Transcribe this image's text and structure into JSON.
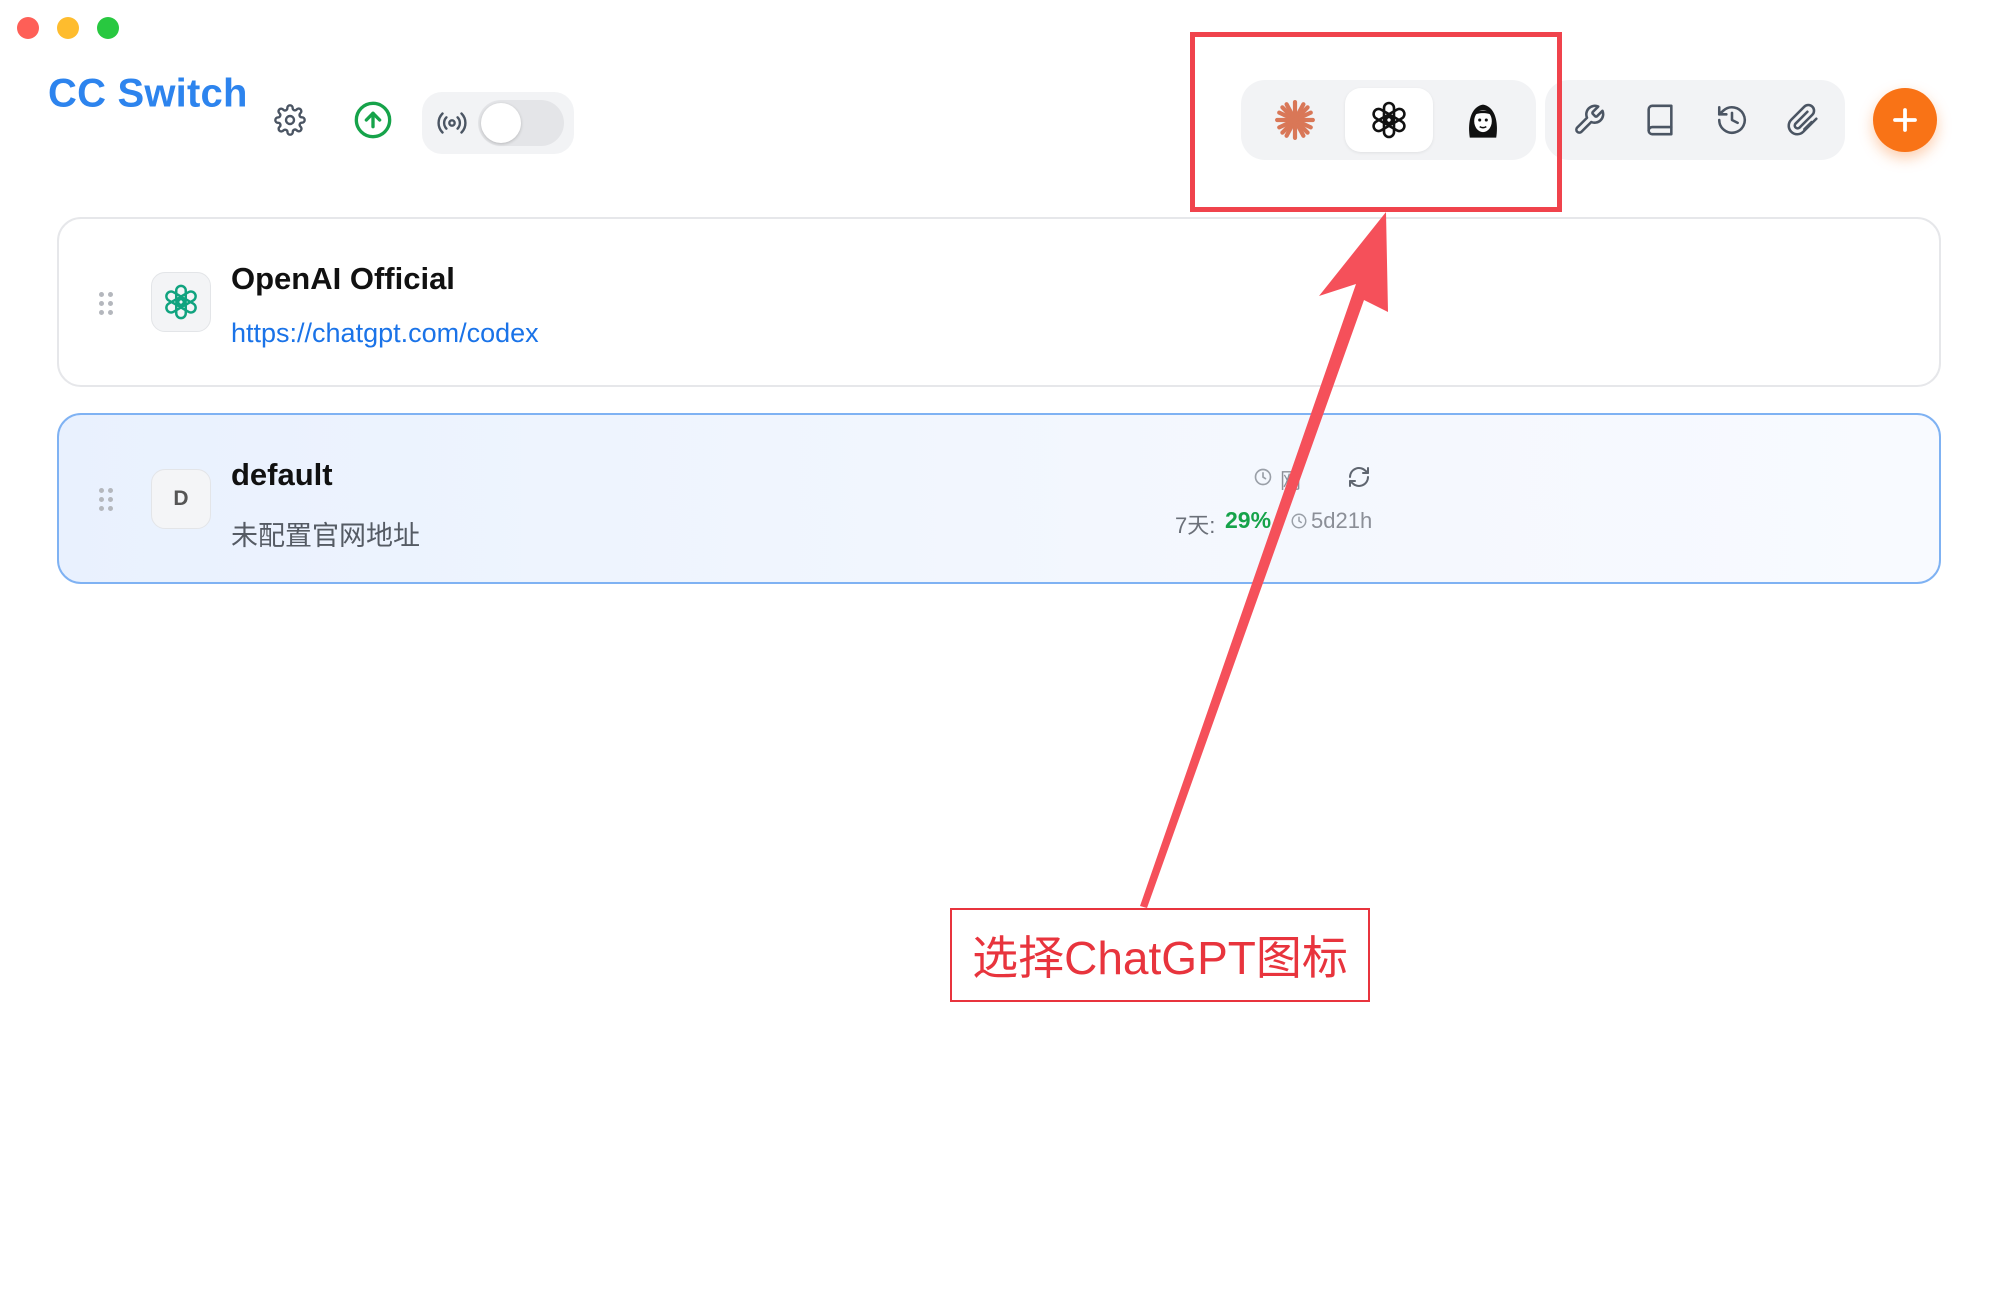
{
  "window": {
    "traffic_lights": {
      "close": "#fe5f57",
      "minimize": "#febc2e",
      "zoom": "#28c840"
    }
  },
  "header": {
    "title": "CC Switch",
    "accent": "#2d84ee",
    "proxy_toggle": {
      "on": false
    },
    "app_switcher": [
      {
        "name": "claude-icon",
        "active": false
      },
      {
        "name": "openai-icon",
        "active": true
      },
      {
        "name": "gemini-icon",
        "active": false
      }
    ],
    "tools": [
      "wrench-icon",
      "book-icon",
      "history-icon",
      "paperclip-icon"
    ],
    "add_color": "#f97316"
  },
  "providers": [
    {
      "name": "OpenAI Official",
      "url": "https://chatgpt.com/codex",
      "icon": "openai-icon",
      "selected": false
    },
    {
      "name": "default",
      "subtitle": "未配置官网地址",
      "avatar_letter": "D",
      "selected": true,
      "usage": {
        "updated": "刚",
        "window_label": "7天:",
        "percent": "29%",
        "reset": "5d21h",
        "percent_color": "#16a34a"
      }
    }
  ],
  "annotation": {
    "label": "选择ChatGPT图标",
    "color": "#f0434c"
  }
}
